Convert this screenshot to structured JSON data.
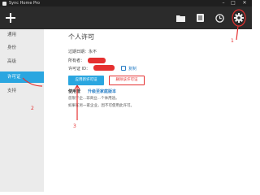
{
  "window": {
    "title": "Sync Home Pro",
    "controls": [
      "minimize-icon",
      "maximize-icon",
      "close-icon"
    ]
  },
  "toolbar": {
    "add_icon": "plus-icon",
    "right_icons": [
      "folder-icon",
      "document-icon",
      "clock-icon",
      "gear-icon"
    ]
  },
  "sidebar": {
    "items": [
      {
        "label": "通用",
        "active": false
      },
      {
        "label": "身份",
        "active": false
      },
      {
        "label": "高级",
        "active": false
      },
      {
        "label": "许可证",
        "active": true
      },
      {
        "label": "支持",
        "active": false
      }
    ]
  },
  "license": {
    "heading": "个人许可",
    "expiry_label": "过期日期：",
    "expiry_value": "永不",
    "owner_label": "所有者：",
    "id_label": "许可证 ID：",
    "copy_label": "复制",
    "apply_button": "应用新许可证",
    "remove_button": "删除该许可证",
    "upsell_title": "使用管",
    "upsell_link": "升级至家庭版本",
    "note_line1": "您限于企...非商业...个体用途。",
    "note_line2": "如果在另一家企业，因不可使用此许可。"
  },
  "annotations": {
    "marker_1": "1",
    "marker_2": "2",
    "marker_3": "3",
    "color": "#e53030"
  },
  "colors": {
    "accent": "#2aa6e0",
    "toolbar_bg": "#2b2b2b",
    "sidebar_bg": "#ebebeb",
    "danger": "#e53030",
    "link": "#2a7fc6"
  }
}
